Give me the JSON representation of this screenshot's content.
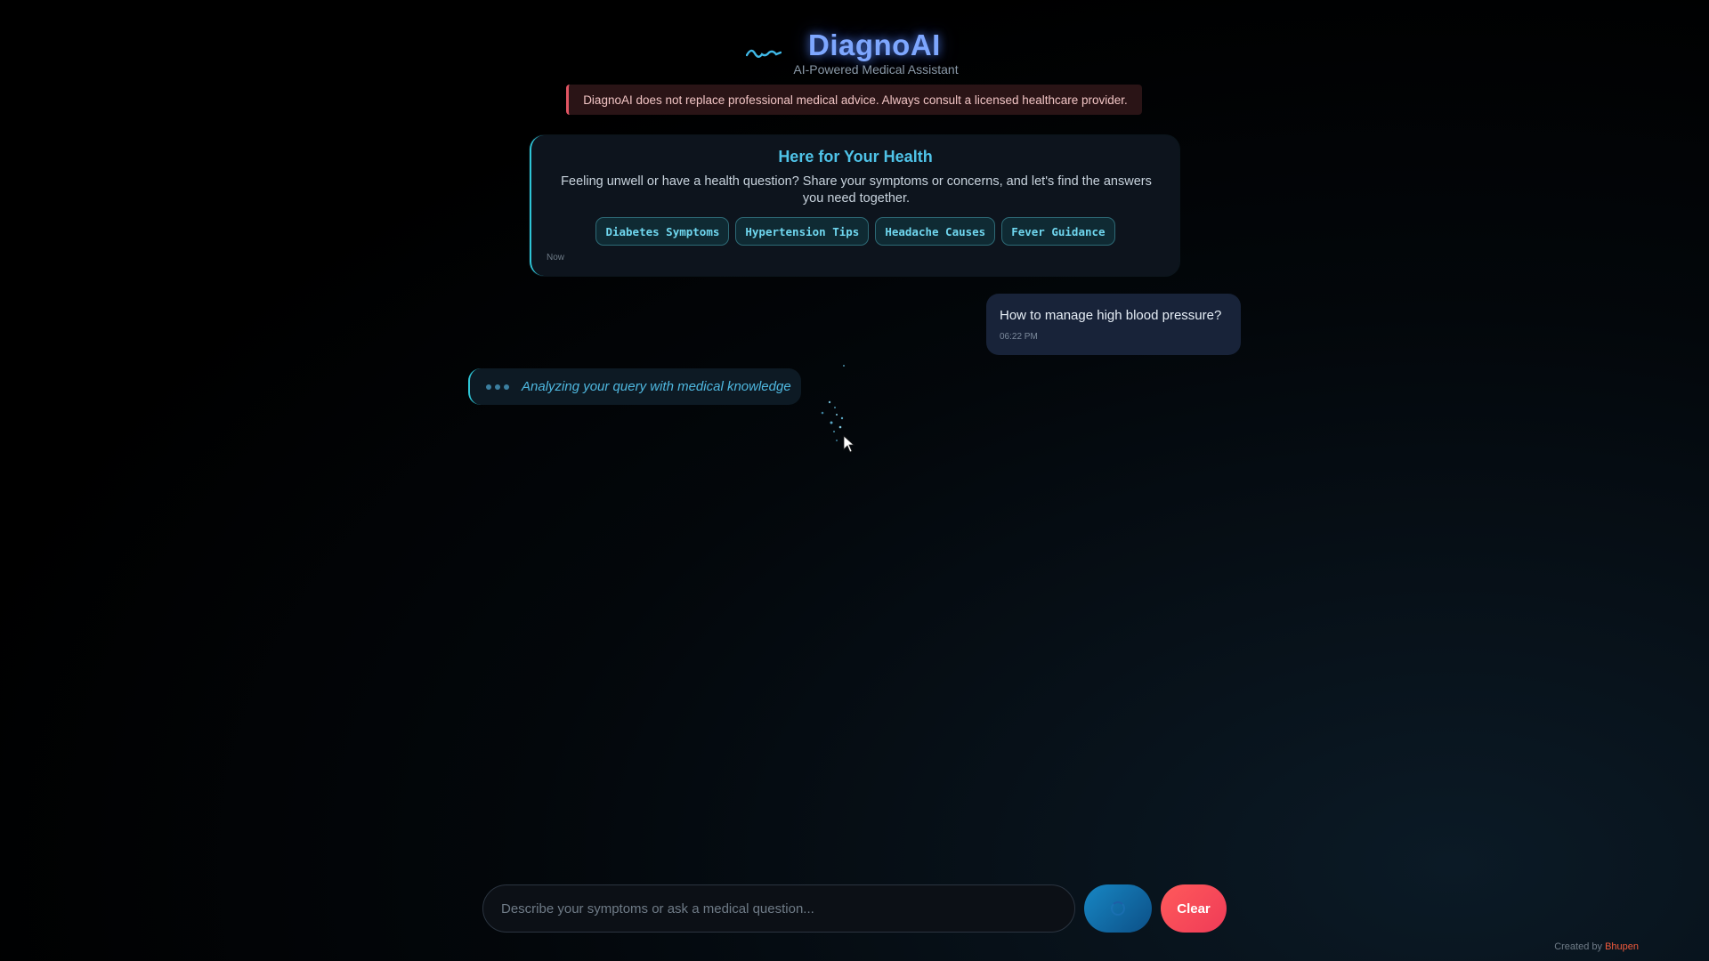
{
  "header": {
    "title": "DiagnoAI",
    "subtitle": "AI-Powered Medical Assistant",
    "logo_icon": "pulse-wave-icon"
  },
  "disclaimer": {
    "text": "DiagnoAI does not replace professional medical advice. Always consult a licensed healthcare provider."
  },
  "welcome": {
    "title": "Here for Your Health",
    "text": "Feeling unwell or have a health question? Share your symptoms or concerns, and let's find the answers you need together.",
    "chips": [
      {
        "label": "Diabetes Symptoms"
      },
      {
        "label": "Hypertension Tips"
      },
      {
        "label": "Headache Causes"
      },
      {
        "label": "Fever Guidance"
      }
    ],
    "time": "Now"
  },
  "messages": [
    {
      "role": "user",
      "text": "How to manage high blood pressure?",
      "time": "06:22 PM"
    }
  ],
  "typing": {
    "text": "Analyzing your query with medical knowledge"
  },
  "composer": {
    "placeholder": "Describe your symptoms or ask a medical question...",
    "value": "",
    "send_icon": "loading-spinner-icon",
    "clear_label": "Clear"
  },
  "footer": {
    "prefix": "Created by",
    "name": "Bhupen"
  },
  "colors": {
    "accent": "#2ec5d6",
    "title_glow": "#7ea7ff",
    "warning": "#e25563",
    "clear_button": "#ff5a5a",
    "send_button": "#1787c4"
  }
}
